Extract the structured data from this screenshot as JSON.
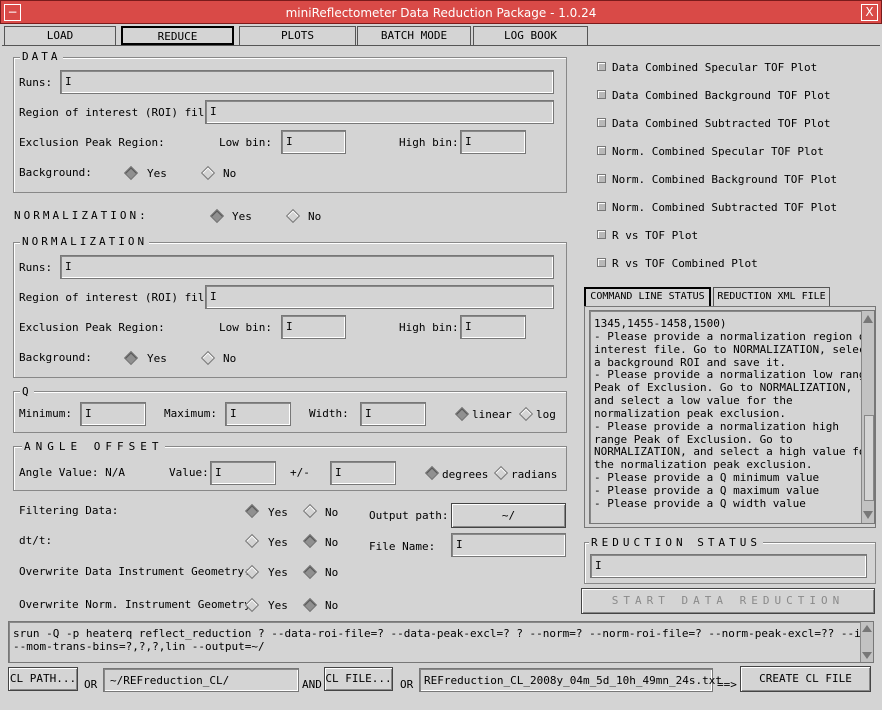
{
  "window": {
    "title": "miniReflectometer Data Reduction Package - 1.0.24",
    "close": "X"
  },
  "tabs": [
    "LOAD",
    "REDUCE",
    "PLOTS",
    "BATCH MODE",
    "LOG BOOK"
  ],
  "data": {
    "title": "DATA",
    "runs_label": "Runs:",
    "roi_label": "Region of interest (ROI) file:",
    "excl_label": "Exclusion Peak Region:",
    "low_label": "Low bin:",
    "high_label": "High bin:",
    "bg_label": "Background:",
    "yes": "Yes",
    "no": "No"
  },
  "normalization_toggle": {
    "label": "NORMALIZATION:",
    "yes": "Yes",
    "no": "No"
  },
  "norm": {
    "title": "NORMALIZATION",
    "runs_label": "Runs:",
    "roi_label": "Region of interest (ROI) file:",
    "excl_label": "Exclusion Peak Region:",
    "low_label": "Low bin:",
    "high_label": "High bin:",
    "bg_label": "Background:",
    "yes": "Yes",
    "no": "No"
  },
  "q": {
    "title": "Q",
    "min_label": "Minimum:",
    "max_label": "Maximum:",
    "width_label": "Width:",
    "linear": "linear",
    "log": "log"
  },
  "angle": {
    "title": "ANGLE OFFSET",
    "value_na": "Angle Value: N/A",
    "value_label": "Value:",
    "pm": "+/-",
    "degrees": "degrees",
    "radians": "radians"
  },
  "options": {
    "filtering": "Filtering Data:",
    "dtt": "dt/t:",
    "overwrite_data": "Overwrite Data Instrument Geometry:",
    "overwrite_norm": "Overwrite Norm. Instrument Geometry:",
    "yes": "Yes",
    "no": "No"
  },
  "output": {
    "path_label": "Output path:",
    "path_value": "~/",
    "file_label": "File Name:"
  },
  "plots": [
    "Data Combined Specular TOF Plot",
    "Data Combined Background TOF Plot",
    "Data Combined Subtracted TOF Plot",
    "Norm. Combined Specular TOF Plot",
    "Norm. Combined Background TOF Plot",
    "Norm. Combined Subtracted TOF Plot",
    "R vs TOF Plot",
    "R vs TOF Combined Plot"
  ],
  "status_tabs": [
    "COMMAND LINE STATUS",
    "REDUCTION XML FILE"
  ],
  "status_lines": [
    "1345,1455-1458,1500)",
    "- Please provide a normalization region of",
    "interest file. Go to NORMALIZATION, select",
    "a background ROI and save it.",
    "- Please provide a normalization low range",
    "Peak of Exclusion. Go to NORMALIZATION,",
    "and select a low value for the",
    "normalization peak exclusion.",
    "- Please provide a normalization high",
    "range Peak of Exclusion. Go to",
    "NORMALIZATION, and select a high value for",
    "the normalization peak exclusion.",
    "- Please provide a Q minimum value",
    "- Please provide a Q maximum value",
    "- Please provide a Q width value"
  ],
  "reduction_status": {
    "title": "REDUCTION STATUS",
    "start_button": "START DATA REDUCTION"
  },
  "command_line": [
    "srun -Q -p heaterq reflect_reduction ? --data-roi-file=? --data-peak-excl=? ? --norm=?  --norm-roi-file=? --norm-peak-excl=?? --inst=REF_L",
    "--mom-trans-bins=?,?,?,lin --output=~/"
  ],
  "bottom": {
    "cl_path_button": "CL PATH...",
    "or1": "OR",
    "path_value": "~/REFreduction_CL/",
    "and": "AND",
    "cl_file_button": "CL FILE...",
    "or2": "OR",
    "file_value": "REFreduction_CL_2008y_04m_5d_10h_49mn_24s.txt",
    "arrow": "==>",
    "create_button": "CREATE CL FILE"
  }
}
